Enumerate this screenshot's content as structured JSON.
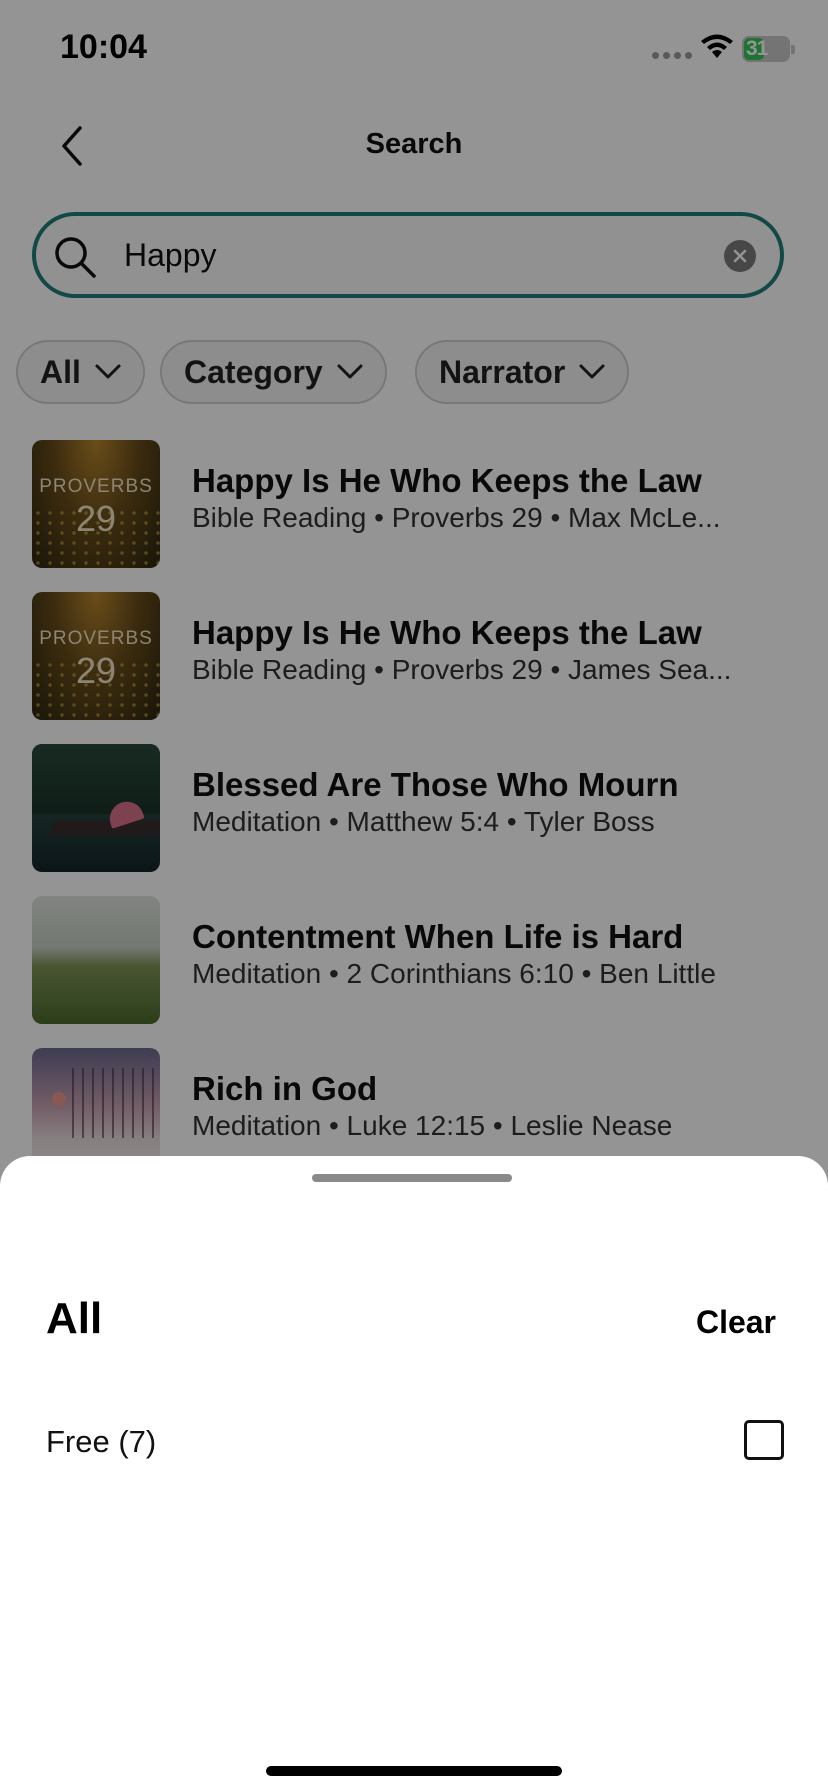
{
  "status_bar": {
    "time": "10:04",
    "battery": "31"
  },
  "nav": {
    "title": "Search"
  },
  "search": {
    "value": "Happy",
    "placeholder": "Search"
  },
  "filters": [
    {
      "label": "All"
    },
    {
      "label": "Category"
    },
    {
      "label": "Narrator"
    }
  ],
  "results": [
    {
      "title": "Happy Is He Who Keeps the Law",
      "subtitle": "Bible Reading • Proverbs 29 • Max McLe...",
      "thumb_line1": "PROVERBS",
      "thumb_line2": "29"
    },
    {
      "title": "Happy Is He Who Keeps the Law",
      "subtitle": "Bible Reading • Proverbs 29 • James Sea...",
      "thumb_line1": "PROVERBS",
      "thumb_line2": "29"
    },
    {
      "title": "Blessed Are Those Who Mourn",
      "subtitle": "Meditation • Matthew 5:4 • Tyler Boss"
    },
    {
      "title": "Contentment When Life is Hard",
      "subtitle": "Meditation • 2 Corinthians 6:10 • Ben Little"
    },
    {
      "title": "Rich in God",
      "subtitle": "Meditation • Luke 12:15 • Leslie Nease"
    }
  ],
  "sheet": {
    "title": "All",
    "clear_label": "Clear",
    "options": [
      {
        "label": "Free (7)",
        "checked": false
      }
    ]
  },
  "colors": {
    "accent": "#1f7f7a"
  }
}
